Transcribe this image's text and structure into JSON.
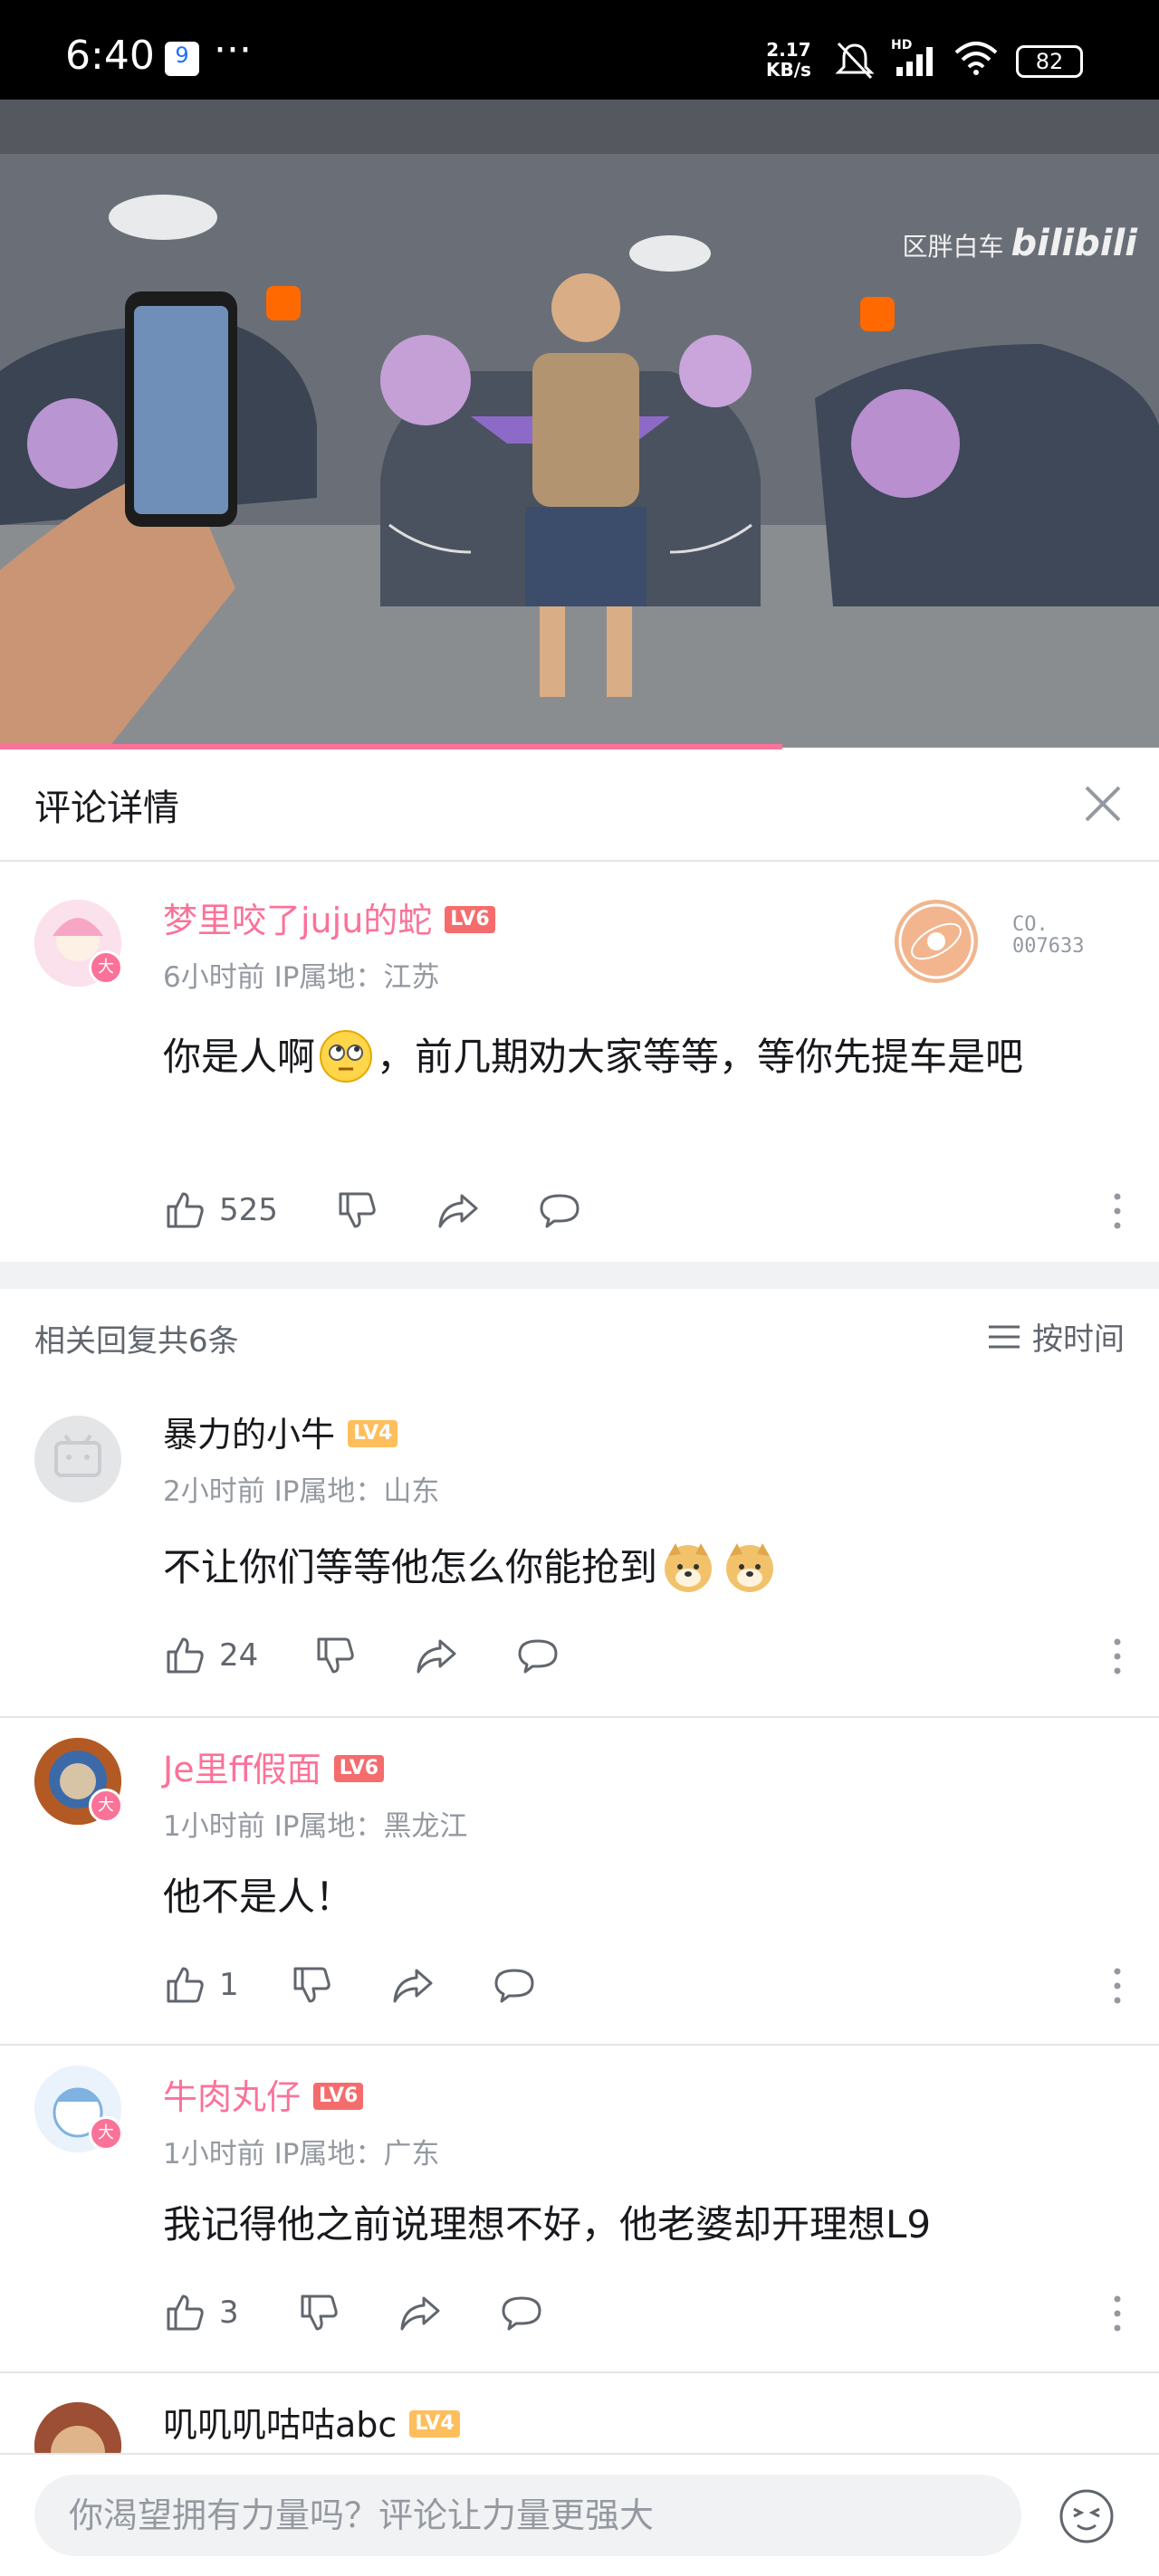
{
  "status_bar": {
    "time": "6:40",
    "speed_value": "2.17",
    "speed_unit": "KB/s",
    "battery": "82"
  },
  "video": {
    "watermark_text": "区胖白车",
    "watermark_brand": "bilibili",
    "progress": 0.675
  },
  "panel": {
    "title": "评论详情"
  },
  "main_comment": {
    "user": "梦里咬了juju的蛇",
    "level": "LV6",
    "time": "6小时前",
    "ip": "IP属地：江苏",
    "text_a": "你是人啊",
    "text_b": "，前几期劝大家等等，等你先提车是吧",
    "likes": "525",
    "medal_no_a": "CO.",
    "medal_no_b": "007633"
  },
  "replies_header": {
    "count": "相关回复共6条",
    "sort": "按时间"
  },
  "replies": [
    {
      "user": "暴力的小牛",
      "level": "LV4",
      "time": "2小时前",
      "ip": "IP属地：山东",
      "text": "不让你们等等他怎么你能抢到",
      "likes": "24"
    },
    {
      "user": "Je里ff假面",
      "level": "LV6",
      "time": "1小时前",
      "ip": "IP属地：黑龙江",
      "text": "他不是人！",
      "likes": "1"
    },
    {
      "user": "牛肉丸仔",
      "level": "LV6",
      "time": "1小时前",
      "ip": "IP属地：广东",
      "text": "我记得他之前说理想不好，他老婆却开理想L9",
      "likes": "3"
    },
    {
      "user": "叽叽叽咕咕abc",
      "level": "LV4"
    }
  ],
  "input": {
    "placeholder": "你渴望拥有力量吗？评论让力量更强大"
  },
  "colors": {
    "accent": "#fb7299",
    "lv6": "#f56c6c",
    "lv4": "#ffbe5c"
  }
}
